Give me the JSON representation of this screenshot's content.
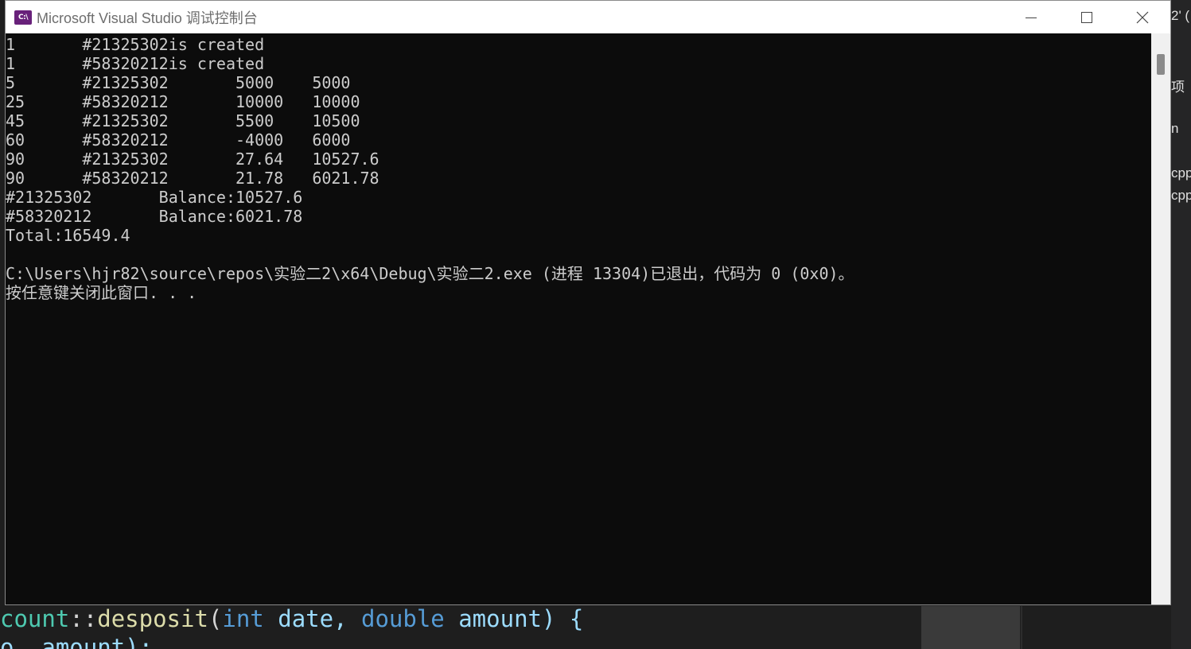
{
  "window": {
    "title": "Microsoft Visual Studio 调试控制台",
    "app_icon": "C:\\"
  },
  "console": {
    "lines": [
      "1       #21325302is created",
      "1       #58320212is created",
      "5       #21325302       5000    5000",
      "25      #58320212       10000   10000",
      "45      #21325302       5500    10500",
      "60      #58320212       -4000   6000",
      "90      #21325302       27.64   10527.6",
      "90      #58320212       21.78   6021.78",
      "#21325302       Balance:10527.6",
      "#58320212       Balance:6021.78",
      "Total:16549.4",
      "",
      "C:\\Users\\hjr82\\source\\repos\\实验二2\\x64\\Debug\\实验二2.exe (进程 13304)已退出，代码为 0 (0x0)。",
      "按任意键关闭此窗口. . ."
    ]
  },
  "background_ide": {
    "code_line_1": {
      "type": "count",
      "sep": "::",
      "func": "desposit",
      "open": "(",
      "kw1": "int",
      "p1": " date, ",
      "kw2": "double",
      "p2": " amount) {"
    },
    "code_line_2": "o  amount);",
    "right_panel": [
      "2' (",
      "项",
      "n",
      "cpp",
      "cpp"
    ]
  }
}
